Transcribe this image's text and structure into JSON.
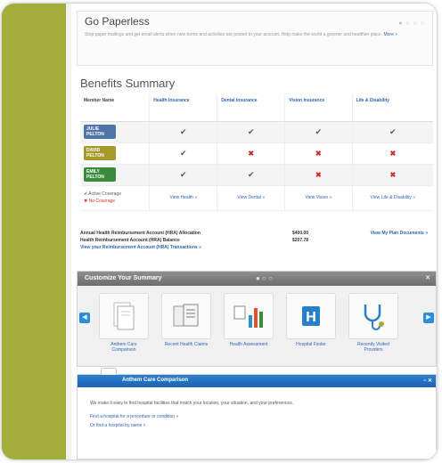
{
  "paperless": {
    "title": "Go Paperless",
    "body": "Stop paper mailings and get email alerts when new forms and activities are posted to your account. Help make the world a greener and healthier place.",
    "more": "More »"
  },
  "benefits": {
    "title": "Benefits Summary",
    "headers": [
      "Member Name",
      "Health Insurance",
      "Dental Insurance",
      "Vision Insurance",
      "Life & Disability"
    ],
    "members": [
      {
        "name": "JULIE",
        "sub": "PELTON",
        "color": "#4f74a8",
        "marks": [
          "check",
          "check",
          "check",
          "check"
        ]
      },
      {
        "name": "DAVID",
        "sub": "PELTON",
        "color": "#a59a2a",
        "marks": [
          "check",
          "x",
          "x",
          "x"
        ]
      },
      {
        "name": "EMILY",
        "sub": "PELTON",
        "color": "#3a8a3c",
        "marks": [
          "check",
          "check",
          "x",
          "x"
        ]
      }
    ],
    "legend_active": "✔ Active Coverage",
    "legend_none": "✖ No Coverage",
    "links": [
      "View Health »",
      "View Dental »",
      "View Vision »",
      "View Life & Disability »"
    ],
    "check_glyph": "✔",
    "x_glyph": "✖"
  },
  "hra": {
    "allocation_label": "Annual Health Reimbursement Account (HRA) Allocation",
    "allocation_value": "$400.00",
    "balance_label": "Health Reimbursement Account (HRA) Balance",
    "balance_value": "$207.78",
    "transactions_link": "View your Reimbursement Account (HRA) Transactions »",
    "plan_documents_link": "View My Plan Documents »"
  },
  "customize": {
    "title": "Customize Your Summary",
    "pager": "● ○ ○",
    "close": "✕",
    "left_arrow": "◀",
    "right_arrow": "▶",
    "tiles": [
      {
        "label": "Anthem Care Comparison",
        "icon": "document-icon"
      },
      {
        "label": "Recent Health Claims",
        "icon": "claims-icon"
      },
      {
        "label": "Health Assessment",
        "icon": "chart-icon"
      },
      {
        "label": "Hospital Finder",
        "icon": "hospital-icon"
      },
      {
        "label": "Recently Visited Providers",
        "icon": "stethoscope-icon"
      }
    ]
  },
  "comparison": {
    "title": "Anthem Care Comparison",
    "icons": "− ✕",
    "text": "We make it easy to find hospital facilities that match your location, your situation, and your preferences.",
    "link1": "Find a hospital for a procedure or condition »",
    "link2": "Or find a hospital by name »"
  }
}
